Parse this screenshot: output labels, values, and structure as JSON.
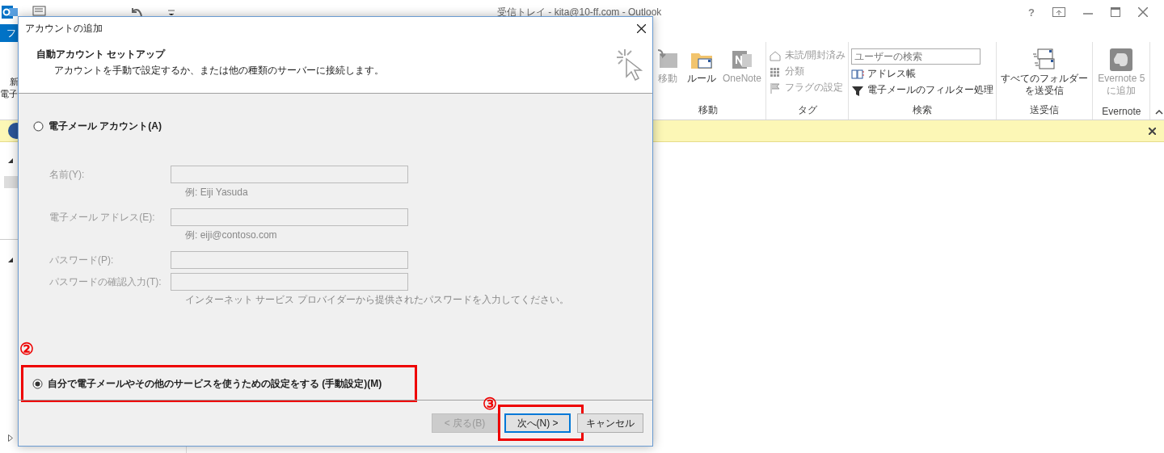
{
  "window": {
    "title": "受信トレイ - kita@10-ff.com - Outlook",
    "help": "?"
  },
  "file_tab": {
    "label": "フ"
  },
  "left_fragments": [
    "新",
    "電子"
  ],
  "ribbon": {
    "groups": [
      {
        "label": "移動",
        "items": [
          {
            "kind": "large",
            "label": "移動",
            "disabled": true
          },
          {
            "kind": "large",
            "label": "ルール",
            "disabled": false
          },
          {
            "kind": "large",
            "label": "OneNote",
            "disabled": true
          }
        ]
      },
      {
        "label": "タグ",
        "items": [
          {
            "kind": "small",
            "label": "未読/開封済み",
            "disabled": true
          },
          {
            "kind": "small",
            "label": "分類",
            "disabled": true
          },
          {
            "kind": "small",
            "label": "フラグの設定",
            "disabled": true
          }
        ]
      },
      {
        "label": "検索",
        "items": [
          {
            "kind": "search",
            "placeholder": "ユーザーの検索"
          },
          {
            "kind": "small",
            "label": "アドレス帳",
            "disabled": false
          },
          {
            "kind": "small",
            "label": "電子メールのフィルター処理",
            "disabled": false
          }
        ]
      },
      {
        "label": "送受信",
        "items": [
          {
            "kind": "large",
            "label": "すべてのフォルダーを送受信",
            "disabled": false
          }
        ]
      },
      {
        "label": "Evernote",
        "items": [
          {
            "kind": "large",
            "label": "Evernote 5 に追加",
            "disabled": true
          }
        ]
      }
    ]
  },
  "dialog": {
    "title": "アカウントの追加",
    "heading": "自動アカウント セットアップ",
    "subtitle": "アカウントを手動で設定するか、または他の種類のサーバーに接続します。",
    "options": [
      {
        "label": "電子メール アカウント(A)",
        "selected": false
      },
      {
        "label": "自分で電子メールやその他のサービスを使うための設定をする (手動設定)(M)",
        "selected": true
      }
    ],
    "fields": [
      {
        "label": "名前(Y):",
        "hint": "例: Eiji Yasuda",
        "disabled": true
      },
      {
        "label": "電子メール アドレス(E):",
        "hint": "例: eiji@contoso.com",
        "disabled": true
      },
      {
        "label": "パスワード(P):",
        "disabled": true
      },
      {
        "label": "パスワードの確認入力(T):",
        "hint": "インターネット サービス プロバイダーから提供されたパスワードを入力してください。",
        "disabled": true
      }
    ],
    "buttons": [
      {
        "label": "< 戻る(B)",
        "disabled": true,
        "default": false
      },
      {
        "label": "次へ(N) >",
        "disabled": false,
        "default": true
      },
      {
        "label": "キャンセル",
        "disabled": false,
        "default": false
      }
    ]
  },
  "annotations": [
    {
      "number": "②"
    },
    {
      "number": "③"
    }
  ]
}
